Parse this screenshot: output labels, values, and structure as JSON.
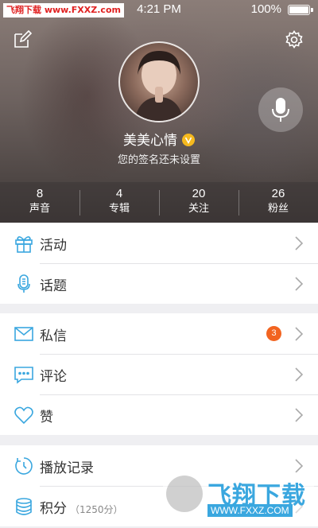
{
  "status_bar": {
    "watermark": "飞翔下载 www.FXXZ.com",
    "time": "4:21 PM",
    "battery": "100%"
  },
  "profile": {
    "username": "美美心情",
    "signature": "您的签名还未设置",
    "vip_badge": "V"
  },
  "stats": [
    {
      "count": "8",
      "label": "声音"
    },
    {
      "count": "4",
      "label": "专辑"
    },
    {
      "count": "20",
      "label": "关注"
    },
    {
      "count": "26",
      "label": "粉丝"
    }
  ],
  "menu": {
    "activity": "活动",
    "topics": "话题",
    "messages": "私信",
    "messages_badge": "3",
    "comments": "评论",
    "likes": "赞",
    "history": "播放记录",
    "points": "积分",
    "points_value": "（1250分）"
  },
  "watermark_bottom": {
    "title": "飞翔下载",
    "url": "WWW.FXXZ.COM"
  },
  "colors": {
    "accent": "#3aa7df",
    "badge": "#f26420",
    "vip": "#f5b91e"
  }
}
